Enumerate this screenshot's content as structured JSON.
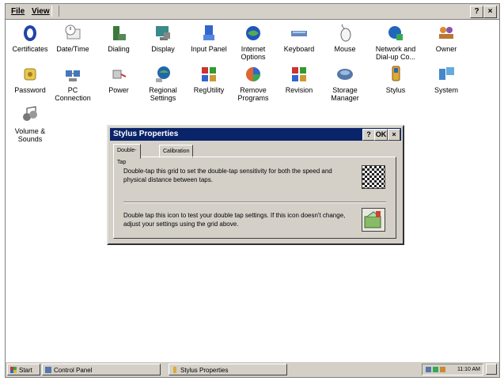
{
  "menubar": {
    "file": "File",
    "view": "View",
    "help_button": "?",
    "close_button": "×"
  },
  "icons": [
    {
      "label": "Certificates",
      "icon": "certificate-icon"
    },
    {
      "label": "Date/Time",
      "icon": "clock-icon"
    },
    {
      "label": "Dialing",
      "icon": "phone-icon"
    },
    {
      "label": "Display",
      "icon": "monitor-icon"
    },
    {
      "label": "Input Panel",
      "icon": "keyboard-panel-icon"
    },
    {
      "label": "Internet\nOptions",
      "icon": "globe-icon"
    },
    {
      "label": "Keyboard",
      "icon": "keyboard-icon"
    },
    {
      "label": "Mouse",
      "icon": "mouse-icon"
    },
    {
      "label": "Network and\nDial-up Co...",
      "icon": "network-icon"
    },
    {
      "label": "Owner",
      "icon": "people-icon"
    },
    {
      "label": "Password",
      "icon": "key-icon"
    },
    {
      "label": "PC\nConnection",
      "icon": "pc-icon"
    },
    {
      "label": "Power",
      "icon": "plug-icon"
    },
    {
      "label": "Regional\nSettings",
      "icon": "globe-regional-icon"
    },
    {
      "label": "RegUtility",
      "icon": "registry-icon"
    },
    {
      "label": "Remove\nPrograms",
      "icon": "remove-programs-icon"
    },
    {
      "label": "Revision",
      "icon": "revision-icon"
    },
    {
      "label": "Storage\nManager",
      "icon": "disk-icon"
    },
    {
      "label": "Stylus",
      "icon": "stylus-icon"
    },
    {
      "label": "System",
      "icon": "system-icon"
    },
    {
      "label": "Volume &\nSounds",
      "icon": "speaker-icon"
    }
  ],
  "dialog": {
    "title": "Stylus Properties",
    "help": "?",
    "ok": "OK",
    "close": "×",
    "tabs": [
      "Double-Tap",
      "Calibration"
    ],
    "text_top": "Double-tap this grid to set the double-tap sensitivity for both the speed and physical distance between taps.",
    "text_bottom": "Double tap this icon to test your double tap settings. If this icon doesn't change, adjust your settings using the grid above."
  },
  "taskbar": {
    "start": "Start",
    "control_panel": "Control Panel",
    "stylus_properties": "Stylus Properties",
    "clock": "11:10 AM"
  },
  "colors": {
    "title_bar": "#0a246a",
    "chrome": "#d4d0c8"
  }
}
